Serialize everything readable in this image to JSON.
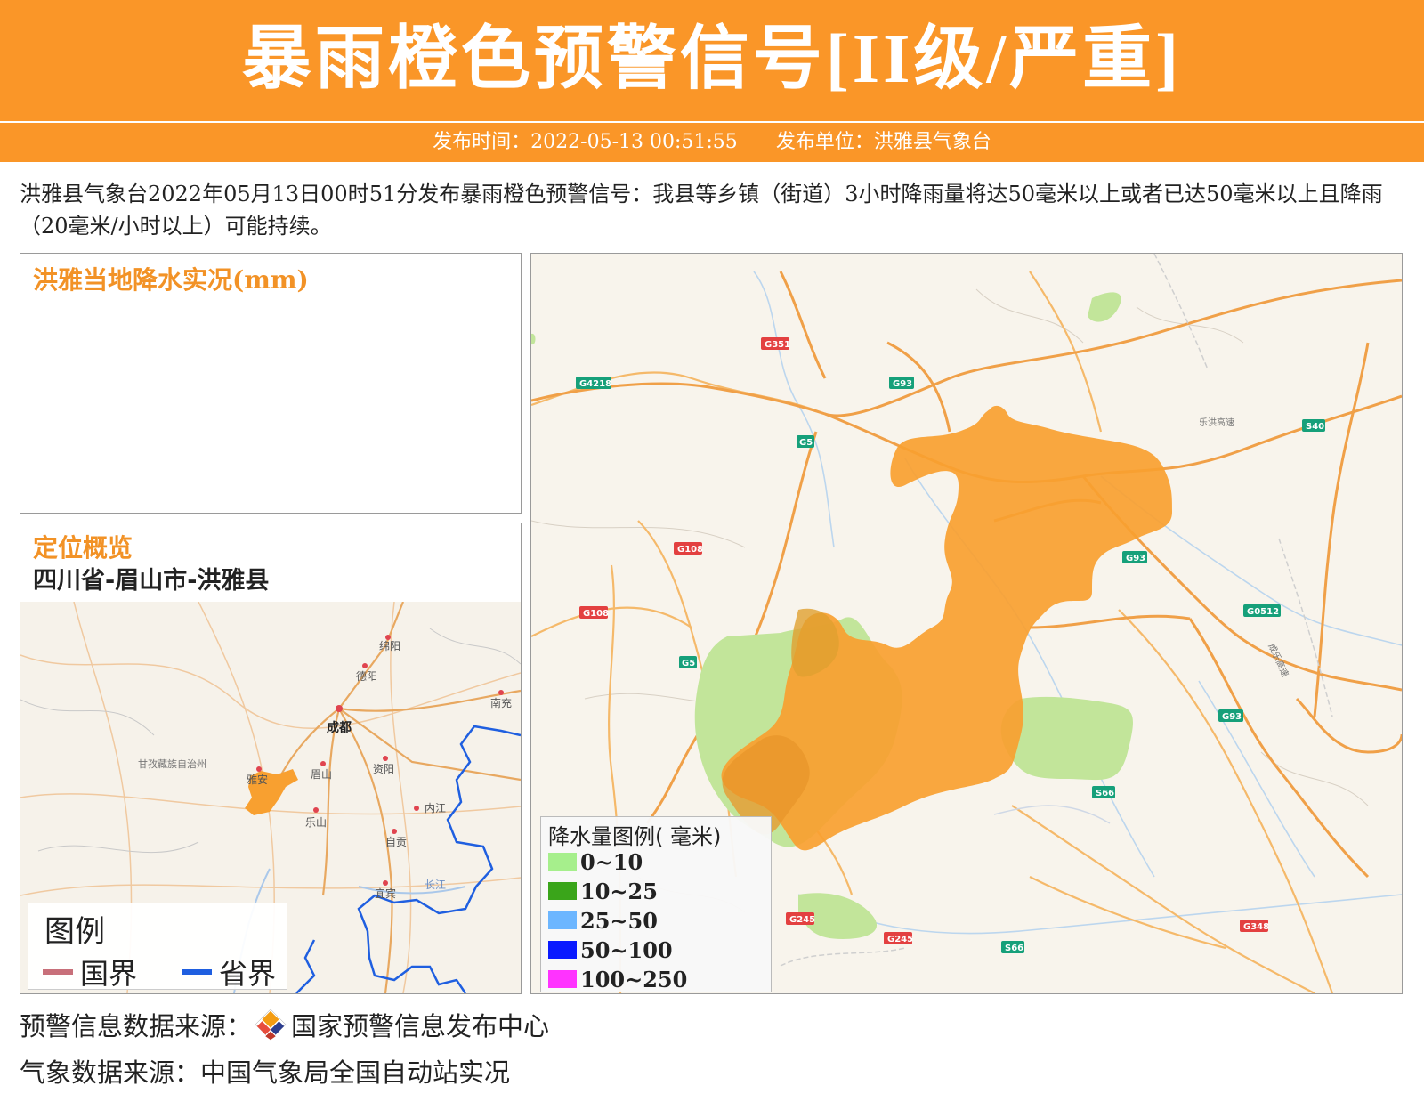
{
  "header": {
    "title": "暴雨橙色预警信号",
    "level": "[II级/严重]",
    "publish_time_label": "发布时间：2022-05-13 00:51:55",
    "publish_unit_label": "发布单位：洪雅县气象台"
  },
  "description": "洪雅县气象台2022年05月13日00时51分发布暴雨橙色预警信号：我县等乡镇（街道）3小时降雨量将达50毫米以上或者已达50毫米以上且降雨（20毫米/小时以上）可能持续。",
  "precip_panel": {
    "title": "洪雅当地降水实况(mm)"
  },
  "location_panel": {
    "title": "定位概览",
    "location": "四川省-眉山市-洪雅县",
    "cities": [
      "绵阳",
      "德阳",
      "成都",
      "南充",
      "甘孜藏族自治州",
      "雅安",
      "眉山",
      "资阳",
      "乐山",
      "内江",
      "自贡",
      "宜宾",
      "长江"
    ],
    "legend": {
      "title": "图例",
      "national_border": "国界",
      "provincial_border": "省界"
    },
    "colors": {
      "national_border": "#c8707a",
      "provincial_border": "#1f5fe0",
      "county_fill": "#f8a030"
    }
  },
  "detail_map": {
    "road_labels": [
      "G351",
      "G4218",
      "G93",
      "G5",
      "S40",
      "乐洪高速",
      "G108",
      "G108",
      "G93",
      "G0512",
      "G5",
      "G93",
      "S66",
      "G245",
      "G245",
      "S66",
      "G348",
      "成乐高速"
    ],
    "legend": {
      "title": "降水量图例( 毫米)",
      "items": [
        {
          "label": "0~10",
          "color": "#a6ef8c"
        },
        {
          "label": "10~25",
          "color": "#3aa51a"
        },
        {
          "label": "25~50",
          "color": "#6cb6ff"
        },
        {
          "label": "50~100",
          "color": "#0a1aff"
        },
        {
          "label": "100~250",
          "color": "#ff33ff"
        }
      ]
    },
    "colors": {
      "warning_area": "#f8a030",
      "light_rain": "#c2e59a"
    }
  },
  "footer": {
    "warning_source": "预警信息数据来源：",
    "warning_source_name": "国家预警信息发布中心",
    "weather_source": "气象数据来源：中国气象局全国自动站实况"
  },
  "brand_color": "#fa9628"
}
